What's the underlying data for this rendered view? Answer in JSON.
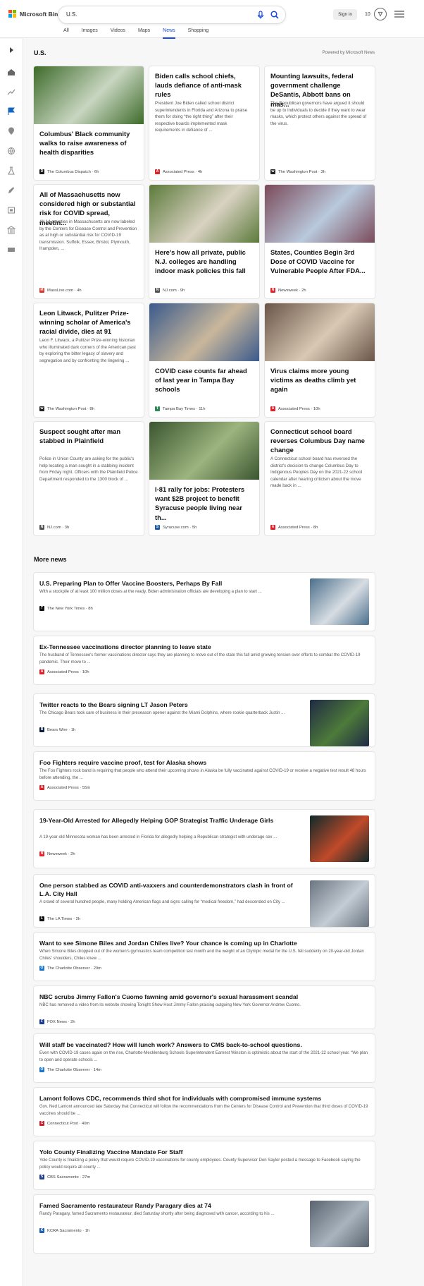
{
  "header": {
    "logo_text": "Microsoft Bing",
    "search_value": "U.S.",
    "signin_label": "Sign in",
    "rewards_count": "10",
    "tabs": [
      {
        "label": "All"
      },
      {
        "label": "Images"
      },
      {
        "label": "Videos"
      },
      {
        "label": "Maps"
      },
      {
        "label": "News",
        "active": true
      },
      {
        "label": "Shopping"
      }
    ]
  },
  "section": {
    "title": "U.S.",
    "powered_by": "Powered by Microsoft News"
  },
  "cards": [
    {
      "headline": "Columbus' Black community walks to raise awareness of health disparities",
      "snippet": "",
      "source": "The Columbus Dispatch",
      "age": "6h",
      "icon": "D",
      "icon_color": "#1a1a1a",
      "has_image": true,
      "image_colors": [
        "#3e6b2a",
        "#c8d6c1"
      ]
    },
    {
      "headline": "Biden calls school chiefs, lauds defiance of anti-mask rules",
      "snippet": "President Joe Biden called school district superintendents in Florida and Arizona to praise them for doing “the right thing” after their respective boards implemented mask requirements in defiance of ...",
      "source": "Associated Press",
      "age": "4h",
      "icon": "AP",
      "icon_color": "#e31f26",
      "has_image": false
    },
    {
      "headline": "Mounting lawsuits, federal government challenge DeSantis, Abbott bans on mas...",
      "snippet": "The Republican governors have argued it should be up to individuals to decide if they want to wear masks, which protect others against the spread of the virus.",
      "source": "The Washington Post",
      "age": "3h",
      "icon": "wp",
      "icon_color": "#222222",
      "has_image": false
    },
    {
      "headline": "All of Massachusetts now considered high or substantial risk for COVID spread, meetin...",
      "snippet": "All 14 counties in Massachusetts are now labeled by the Centers for Disease Control and Prevention as at high or substantial risk for COVID-19 transmission. Suffolk, Essex, Bristol, Plymouth, Hampden, ...",
      "source": "MassLive.com",
      "age": "4h",
      "icon": "M",
      "icon_color": "#d63a2f",
      "has_image": false
    },
    {
      "headline": "Here's how all private, public N.J. colleges are handling indoor mask policies this fall",
      "snippet": "",
      "source": "NJ.com",
      "age": "9h",
      "icon": "NJ",
      "icon_color": "#555555",
      "has_image": true,
      "image_colors": [
        "#5c7a3b",
        "#d9d2c2"
      ]
    },
    {
      "headline": "States, Counties Begin 3rd Dose of COVID Vaccine for Vulnerable People After FDA...",
      "snippet": "",
      "source": "Newsweek",
      "age": "2h",
      "icon": "N",
      "icon_color": "#e3262d",
      "has_image": true,
      "image_colors": [
        "#7a4a5a",
        "#b9c9dc"
      ]
    },
    {
      "headline": "Leon Litwack, Pulitzer Prize-winning scholar of America's racial divide, dies at 91",
      "snippet": "Leon F. Litwack, a Pulitzer Prize-winning historian who illuminated dark corners of the American past by exploring the bitter legacy of slavery and segregation and by confronting the lingering ...",
      "source": "The Washington Post",
      "age": "8h",
      "icon": "wp",
      "icon_color": "#222222",
      "has_image": false
    },
    {
      "headline": "COVID case counts far ahead of last year in Tampa Bay schools",
      "snippet": "",
      "source": "Tampa Bay Times",
      "age": "11h",
      "icon": "T",
      "icon_color": "#2e8b57",
      "has_image": true,
      "image_colors": [
        "#3a5a8c",
        "#c9b79c"
      ]
    },
    {
      "headline": "Virus claims more young victims as deaths climb yet again",
      "snippet": "",
      "source": "Associated Press",
      "age": "10h",
      "icon": "AP",
      "icon_color": "#e31f26",
      "has_image": true,
      "image_colors": [
        "#6a5548",
        "#d8c9b4"
      ]
    },
    {
      "headline": "Suspect sought after man stabbed in Plainfield",
      "snippet": "Police in Union County are asking for the public's help locating a man sought in a stabbing incident from Friday night. Officers with the Plainfield Police Department responded to the 1300 block of ...",
      "source": "NJ.com",
      "age": "3h",
      "icon": "NJ",
      "icon_color": "#555555",
      "has_image": false
    },
    {
      "headline": "I-81 rally for jobs: Protesters want $2B project to benefit Syracuse people living near th...",
      "snippet": "",
      "source": "Syracuse.com",
      "age": "5h",
      "icon": "S",
      "icon_color": "#1c5aa6",
      "has_image": true,
      "image_colors": [
        "#3b5530",
        "#9cb47e"
      ]
    },
    {
      "headline": "Connecticut school board reverses Columbus Day name change",
      "snippet": "A Connecticut school board has reversed the district's decision to change Columbus Day to Indigenous Peoples Day on the 2021-22 school calendar after hearing criticism about the move made back in ...",
      "source": "Associated Press",
      "age": "8h",
      "icon": "AP",
      "icon_color": "#e31f26",
      "has_image": false
    }
  ],
  "more_news": {
    "title": "More news",
    "items": [
      {
        "headline": "U.S. Preparing Plan to Offer Vaccine Boosters, Perhaps By Fall",
        "snippet": "With a stockpile of at least 100 million doses at the ready, Biden administration officials are developing a plan to start ...",
        "source": "The New York Times",
        "age": "8h",
        "icon": "T",
        "icon_color": "#111111",
        "has_image": true,
        "image_colors": [
          "#4b6f8c",
          "#d7dde2"
        ]
      },
      {
        "headline": "Ex-Tennessee vaccinations director planning to leave state",
        "snippet": "The husband of Tennessee's former vaccinations director says they are planning to move out of the state this fall amid growing tension over efforts to combat the COVID-19 pandemic. Their move to ...",
        "source": "Associated Press",
        "age": "10h",
        "icon": "AP",
        "icon_color": "#e31f26",
        "has_image": false
      },
      {
        "headline": "Twitter reacts to the Bears signing LT Jason Peters",
        "snippet": "The Chicago Bears took care of business in their preseason opener against the Miami Dolphins, where rookie quarterback Justin ...",
        "source": "Bears Wire",
        "age": "1h",
        "icon": "B",
        "icon_color": "#0b1f3a",
        "has_image": true,
        "image_colors": [
          "#1f2a44",
          "#4d7a3a"
        ]
      },
      {
        "headline": "Foo Fighters require vaccine proof, test for Alaska shows",
        "snippet": "The Foo Fighters rock band is requiring that people who attend their upcoming shows in Alaska be fully vaccinated against COVID-19 or receive a negative test result 48 hours before attending, the ...",
        "source": "Associated Press",
        "age": "55m",
        "icon": "AP",
        "icon_color": "#e31f26",
        "has_image": false
      },
      {
        "headline": "19-Year-Old Arrested for Allegedly Helping GOP Strategist Traffic Underage Girls",
        "snippet": "A 19-year-old Minnesota woman has been arrested in Florida for allegedly helping a Republican strategist with underage sex ...",
        "source": "Newsweek",
        "age": "2h",
        "icon": "N",
        "icon_color": "#e3262d",
        "has_image": true,
        "image_colors": [
          "#0f2a2a",
          "#c04a2a"
        ]
      },
      {
        "headline": "One person stabbed as COVID anti-vaxxers and counterdemonstrators clash in front of L.A. City Hall",
        "snippet": "A crowd of several hundred people, many holding American flags and signs calling for “medical freedom,” had descended on City ...",
        "source": "The LA Times",
        "age": "2h",
        "icon": "L",
        "icon_color": "#111111",
        "has_image": true,
        "image_colors": [
          "#6b7580",
          "#c3ccd4"
        ]
      },
      {
        "headline": "Want to see Simone Biles and Jordan Chiles live? Your chance is coming up in Charlotte",
        "snippet": "When Simone Biles dropped out of the women's gymnastics team competition last month and the weight of an Olympic medal for the U.S. fell suddenly on 20-year-old Jordan Chiles' shoulders, Chiles knew ...",
        "source": "The Charlotte Observer",
        "age": "29m",
        "icon": "O",
        "icon_color": "#1d75c9",
        "has_image": false
      },
      {
        "headline": "NBC scrubs Jimmy Fallon's Cuomo fawning amid governor's sexual harassment scandal",
        "snippet": "NBC has removed a video from its website showing Tonight Show Host Jimmy Fallon praising outgoing New York Governor Andrew Cuomo.",
        "source": "FOX News",
        "age": "2h",
        "icon": "F",
        "icon_color": "#1a3c8c",
        "has_image": false
      },
      {
        "headline": "Will staff be vaccinated? How will lunch work? Answers to CMS back-to-school questions.",
        "snippet": "Even with COVID-19 cases again on the rise, Charlotte-Mecklenburg Schools Superintendent Earnest Winston is optimistic about the start of the 2021-22 school year. “We plan to open and operate schools ...",
        "source": "The Charlotte Observer",
        "age": "14m",
        "icon": "O",
        "icon_color": "#1d75c9",
        "has_image": false
      },
      {
        "headline": "Lamont follows CDC, recommends third shot for individuals with compromised immune systems",
        "snippet": "Gov. Ned Lamont announced late Saturday that Connecticut will follow the recommendations from the Centers for Disease Control and Prevention that third doses of COVID-19 vaccines should be ...",
        "source": "Connecticut Post",
        "age": "40m",
        "icon": "C",
        "icon_color": "#c8202f",
        "has_image": false
      },
      {
        "headline": "Yolo County Finalizing Vaccine Mandate For Staff",
        "snippet": "Yolo County is finalizing a policy that would require COVID-19 vaccinations for county employees. County Supervisor Don Saylor posted a message to Facebook saying the policy would require all county ...",
        "source": "CBS Sacramento",
        "age": "27m",
        "icon": "S",
        "icon_color": "#23408e",
        "has_image": false
      },
      {
        "headline": "Famed Sacramento restaurateur Randy Paragary dies at 74",
        "snippet": "Randy Paragary, famed Sacramento restaurateur, died Saturday shortly after being diagnosed with cancer, according to his ...",
        "source": "KCRA Sacramento",
        "age": "1h",
        "icon": "K",
        "icon_color": "#1d5fb0",
        "has_image": true,
        "image_colors": [
          "#5a6470",
          "#a9b3bd"
        ]
      }
    ]
  }
}
